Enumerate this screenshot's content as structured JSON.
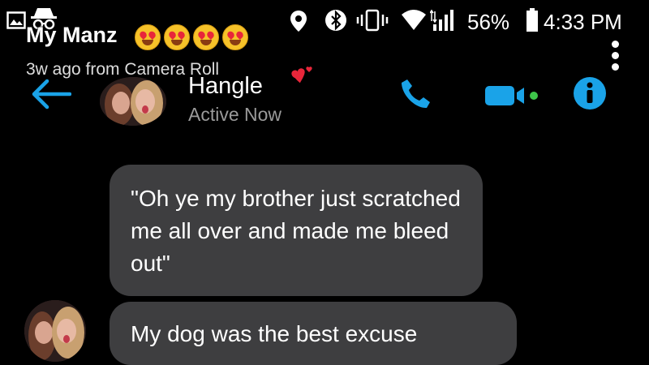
{
  "status_bar": {
    "battery": "56%",
    "time": "4:33 PM",
    "icons": [
      "gallery-icon",
      "incognito-icon",
      "location-icon",
      "bluetooth-icon",
      "vibrate-icon",
      "wifi-icon",
      "signal-icon",
      "battery-icon"
    ]
  },
  "story": {
    "title": "My Manz",
    "emoji": [
      "heart-eyes-emoji",
      "heart-eyes-emoji",
      "heart-eyes-emoji",
      "heart-eyes-emoji"
    ],
    "subtitle": "3w ago from Camera Roll"
  },
  "header": {
    "contact_name": "Hangle",
    "status": "Active Now",
    "accent_color": "#1aa3e8"
  },
  "messages": [
    {
      "from": "contact",
      "text": "\"Oh ye my brother just scratched me all over and made me bleed out\""
    },
    {
      "from": "contact",
      "text": "My dog was the best excuse"
    }
  ],
  "colors": {
    "background": "#000000",
    "bubble": "#3e3e40",
    "accent": "#1aa3e8",
    "heart": "#e8263a"
  }
}
